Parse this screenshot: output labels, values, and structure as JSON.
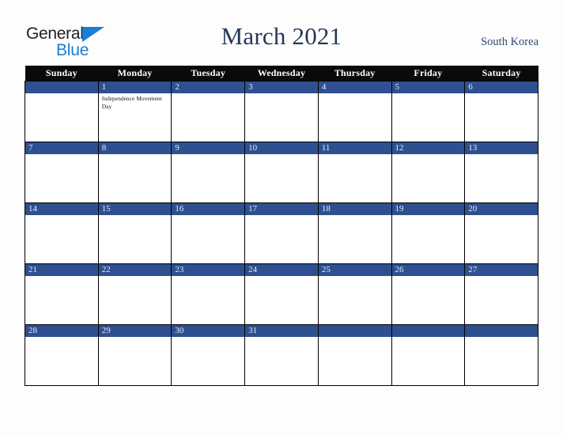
{
  "brand": {
    "name_part1": "General",
    "name_part2": "Blue",
    "triangle_color": "#1a7fd4"
  },
  "header": {
    "title": "March 2021",
    "country": "South Korea"
  },
  "calendar": {
    "weekday_headers": [
      "Sunday",
      "Monday",
      "Tuesday",
      "Wednesday",
      "Thursday",
      "Friday",
      "Saturday"
    ],
    "accent_color": "#2e5090",
    "header_bg": "#0a0a0a",
    "weeks": [
      [
        {
          "day": "",
          "events": []
        },
        {
          "day": "1",
          "events": [
            "Independence Movement Day"
          ]
        },
        {
          "day": "2",
          "events": []
        },
        {
          "day": "3",
          "events": []
        },
        {
          "day": "4",
          "events": []
        },
        {
          "day": "5",
          "events": []
        },
        {
          "day": "6",
          "events": []
        }
      ],
      [
        {
          "day": "7",
          "events": []
        },
        {
          "day": "8",
          "events": []
        },
        {
          "day": "9",
          "events": []
        },
        {
          "day": "10",
          "events": []
        },
        {
          "day": "11",
          "events": []
        },
        {
          "day": "12",
          "events": []
        },
        {
          "day": "13",
          "events": []
        }
      ],
      [
        {
          "day": "14",
          "events": []
        },
        {
          "day": "15",
          "events": []
        },
        {
          "day": "16",
          "events": []
        },
        {
          "day": "17",
          "events": []
        },
        {
          "day": "18",
          "events": []
        },
        {
          "day": "19",
          "events": []
        },
        {
          "day": "20",
          "events": []
        }
      ],
      [
        {
          "day": "21",
          "events": []
        },
        {
          "day": "22",
          "events": []
        },
        {
          "day": "23",
          "events": []
        },
        {
          "day": "24",
          "events": []
        },
        {
          "day": "25",
          "events": []
        },
        {
          "day": "26",
          "events": []
        },
        {
          "day": "27",
          "events": []
        }
      ],
      [
        {
          "day": "28",
          "events": []
        },
        {
          "day": "29",
          "events": []
        },
        {
          "day": "30",
          "events": []
        },
        {
          "day": "31",
          "events": []
        },
        {
          "day": "",
          "events": []
        },
        {
          "day": "",
          "events": []
        },
        {
          "day": "",
          "events": []
        }
      ]
    ]
  }
}
